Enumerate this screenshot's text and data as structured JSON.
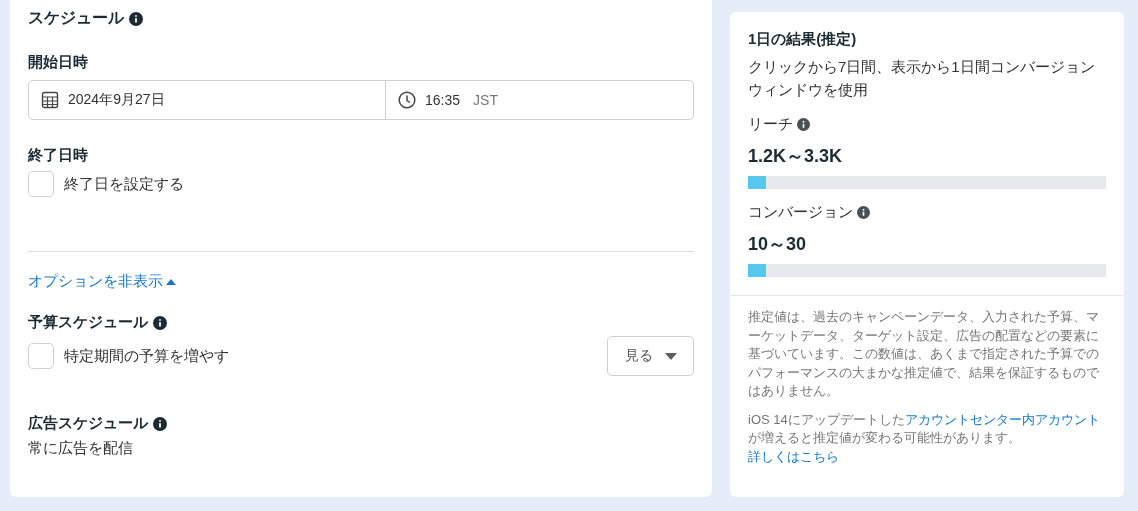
{
  "schedule": {
    "title": "スケジュール",
    "start": {
      "label": "開始日時",
      "date": "2024年9月27日",
      "time": "16:35",
      "timezone": "JST"
    },
    "end": {
      "label": "終了日時",
      "checkbox": {
        "label": "終了日を設定する",
        "checked": false
      }
    }
  },
  "options_toggle": {
    "label": "オプションを非表示",
    "expanded": true
  },
  "budget_schedule": {
    "title": "予算スケジュール",
    "checkbox": {
      "label": "特定期間の予算を増やす",
      "checked": false
    },
    "dropdown": "見る"
  },
  "ad_schedule": {
    "title": "広告スケジュール",
    "value": "常に広告を配信"
  },
  "results": {
    "title": "1日の結果(推定)",
    "description": "クリックから7日間、表示から1日間コンバージョンウィンドウを使用",
    "metrics": [
      {
        "label": "リーチ",
        "value": "1.2K～3.3K",
        "level": 0.05
      },
      {
        "label": "コンバージョン",
        "value": "10～30",
        "level": 0.05
      }
    ],
    "disclaimer": "推定値は、過去のキャンペーンデータ、入力された予算、マーケットデータ、ターゲット設定、広告の配置などの要素に基づいています。この数値は、あくまで指定された予算でのパフォーマンスの大まかな推定値で、結果を保証するものではありません。",
    "note": {
      "text_before": "iOS 14にアップデートした",
      "link": "アカウントセンター内アカウント",
      "text_after": "が増えると推定値が変わる可能性があります。",
      "more_link": "詳しくはこちら"
    }
  }
}
